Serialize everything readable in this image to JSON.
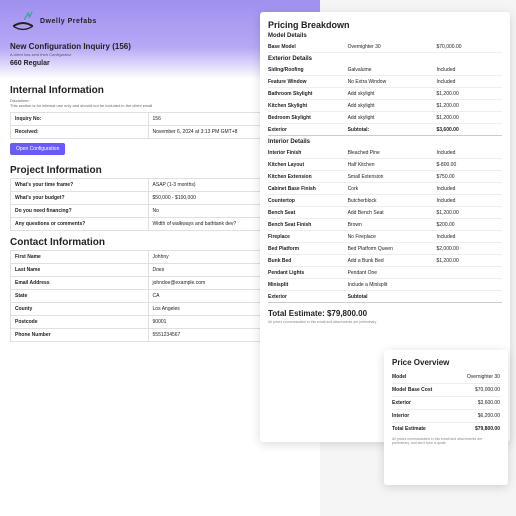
{
  "brand": "Dwelly Prefabs",
  "inquiry": {
    "title": "New Configuration Inquiry (156)",
    "sub": "A client has sent their Configurator",
    "model": "660 Regular"
  },
  "sections": {
    "internal": {
      "title": "Internal Information",
      "disclaim_l": "Disclaimer:",
      "disclaim": "This section is for internal use only and should not be included in the client email",
      "rows": [
        [
          "Inquiry No:",
          "156"
        ],
        [
          "Received:",
          "November 6, 2024 at 3:13 PM GMT+8"
        ]
      ],
      "btn": "Open Configuration"
    },
    "project": {
      "title": "Project Information",
      "rows": [
        [
          "What's your time frame?",
          "ASAP (1-3 months)"
        ],
        [
          "What's your budget?",
          "$50,000 - $100,000"
        ],
        [
          "Do you need financing?",
          "No"
        ],
        [
          "Any questions or comments?",
          "Width of walkways and bathtank dev?"
        ]
      ]
    },
    "contact": {
      "title": "Contact Information",
      "rows": [
        [
          "First Name",
          "Johhny"
        ],
        [
          "Last Name",
          "Does"
        ],
        [
          "Email Address",
          "johndoe@example.com"
        ],
        [
          "State",
          "CA"
        ],
        [
          "County",
          "Los Angeles"
        ],
        [
          "Postcode",
          "90001"
        ],
        [
          "Phone Number",
          "5551234567"
        ]
      ]
    }
  },
  "pricing": {
    "title": "Pricing Breakdown",
    "modelHdr": "Model Details",
    "modelRows": [
      [
        "Base Model",
        "Overnighter 30",
        "$70,000.00"
      ]
    ],
    "extHdr": "Exterior Details",
    "extRows": [
      [
        "Siding/Roofing",
        "Galvalume",
        "Included"
      ],
      [
        "Feature Window",
        "No Extra Window",
        "Included"
      ],
      [
        "Bathroom Skylight",
        "Add skylight",
        "$1,200.00"
      ],
      [
        "Kitchen Skylight",
        "Add skylight",
        "$1,200.00"
      ],
      [
        "Bedroom Skylight",
        "Add skylight",
        "$1,200.00"
      ]
    ],
    "extSub": [
      "Exterior",
      "Subtotal:",
      "$3,600.00"
    ],
    "intHdr": "Interior Details",
    "intRows": [
      [
        "Interior Finish",
        "Bleached Pine",
        "Included"
      ],
      [
        "Kitchen Layout",
        "Half Kitchen",
        "$-800.00"
      ],
      [
        "Kitchen Extension",
        "Small Extension",
        "$750.00"
      ],
      [
        "Cabinet Base Finish",
        "Cork",
        "Included"
      ],
      [
        "Countertop",
        "Butcherblock",
        "Included"
      ],
      [
        "Bench Seat",
        "Add Bench Seat",
        "$1,200.00"
      ],
      [
        "Bench Seat Finish",
        "Brown",
        "$200.00"
      ],
      [
        "Fireplace",
        "No Fireplace",
        "Included"
      ],
      [
        "Bed Platform",
        "Bed Platform Queen",
        "$2,000.00"
      ],
      [
        "Bunk Bed",
        "Add a Bunk Bed",
        "$1,200.00"
      ],
      [
        "Pendant Lights",
        "Pendant One",
        ""
      ],
      [
        "Minisplit",
        "Include a Minisplit",
        ""
      ]
    ],
    "intSub": [
      "Exterior",
      "Subtotal",
      ""
    ],
    "total": "Total Estimate: $79,800.00",
    "fine": "All prices communicated in this email and attachments are preliminary"
  },
  "overview": {
    "title": "Price Overview",
    "rows": [
      [
        "Model",
        "Overnighter 30"
      ],
      [
        "Model Base Cost",
        "$70,000.00"
      ],
      [
        "Exterior",
        "$3,600.00"
      ],
      [
        "Interior",
        "$6,200.00"
      ]
    ],
    "total": [
      "Total Estimate",
      "$79,800.00"
    ],
    "fine": "All prices communicated in this email and attachments are preliminary, and don't form a quote"
  }
}
